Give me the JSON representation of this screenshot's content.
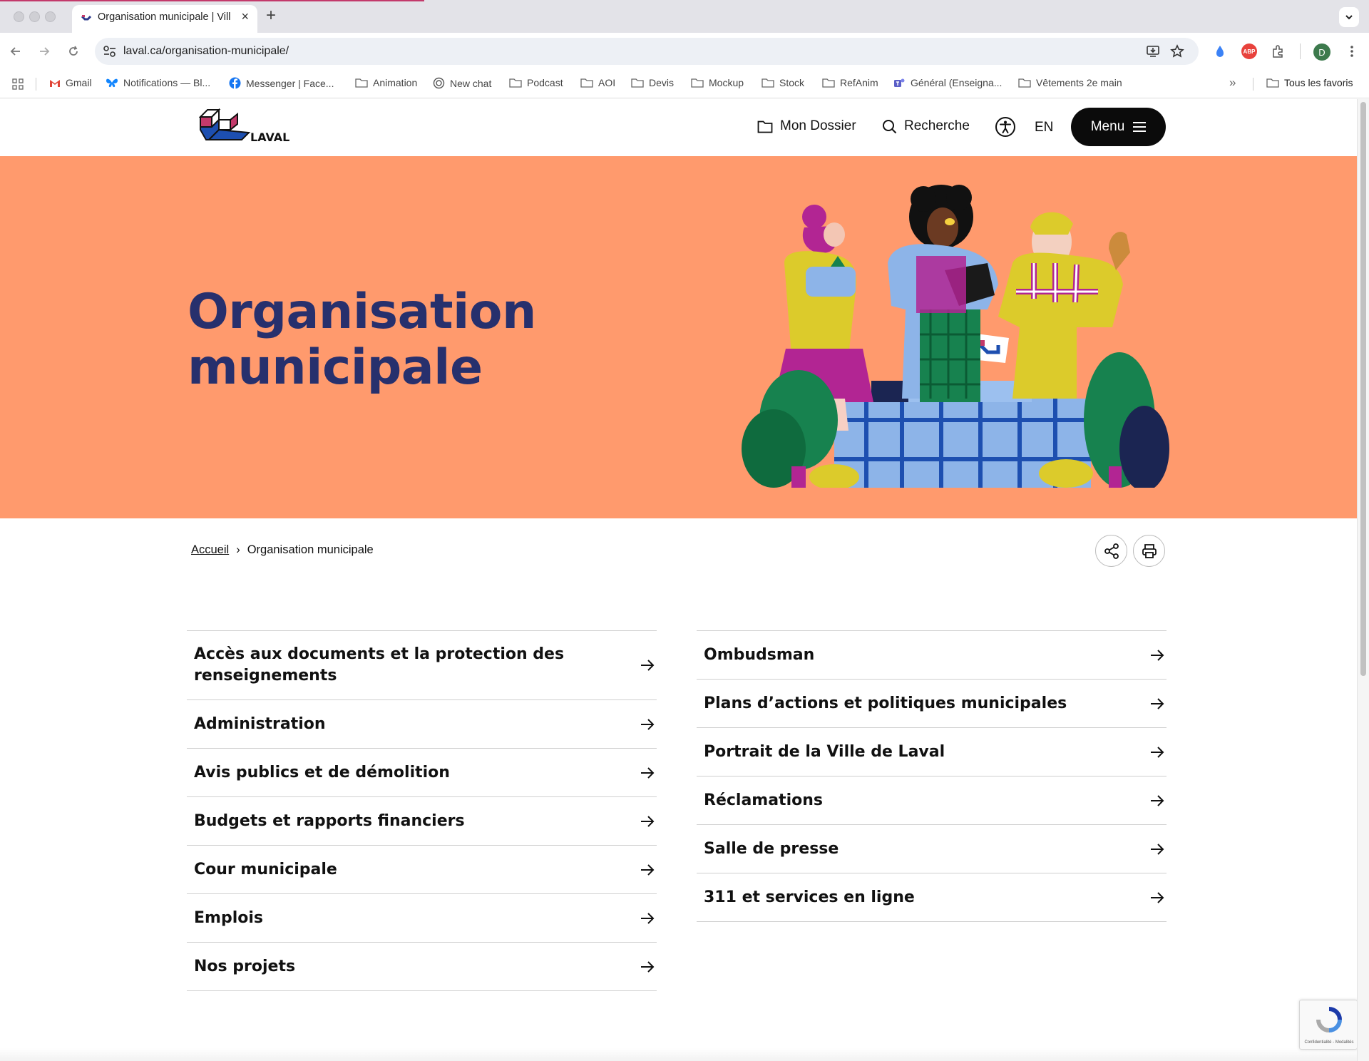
{
  "browser": {
    "tab_title": "Organisation municipale | Vill",
    "url_host": "laval.ca",
    "url_path": "/organisation-municipale/",
    "bookmarks": [
      {
        "label": "Gmail",
        "icon": "gmail-icon"
      },
      {
        "label": "Notifications — Bl...",
        "icon": "butterfly-icon"
      },
      {
        "label": "Messenger | Face...",
        "icon": "facebook-icon"
      },
      {
        "label": "Animation",
        "icon": "folder-icon"
      },
      {
        "label": "New chat",
        "icon": "chatgpt-icon"
      },
      {
        "label": "Podcast",
        "icon": "folder-icon"
      },
      {
        "label": "AOI",
        "icon": "folder-icon"
      },
      {
        "label": "Devis",
        "icon": "folder-icon"
      },
      {
        "label": "Mockup",
        "icon": "folder-icon"
      },
      {
        "label": "Stock",
        "icon": "folder-icon"
      },
      {
        "label": "RefAnim",
        "icon": "folder-icon"
      },
      {
        "label": "Général (Enseigna...",
        "icon": "teams-icon"
      },
      {
        "label": "Vêtements 2e main",
        "icon": "folder-icon"
      }
    ],
    "all_bookmarks": "Tous les favoris",
    "profile_initial": "D",
    "abp_label": "ABP"
  },
  "header": {
    "logo_text": "LAVAL",
    "dossier": "Mon Dossier",
    "search": "Recherche",
    "lang": "EN",
    "menu": "Menu"
  },
  "hero": {
    "title_line1": "Organisation",
    "title_line2": "municipale",
    "background": "#ff9a6d",
    "title_color": "#27306d"
  },
  "breadcrumb": {
    "home": "Accueil",
    "separator": "›",
    "current": "Organisation municipale"
  },
  "links_left": [
    "Accès aux documents et la protection des renseignements",
    "Administration",
    "Avis publics et de démolition",
    "Budgets et rapports financiers",
    "Cour municipale",
    "Emplois",
    "Nos projets"
  ],
  "links_right": [
    "Ombudsman",
    "Plans d’actions et politiques municipales",
    "Portrait de la Ville de Laval",
    "Réclamations",
    "Salle de presse",
    "311 et services en ligne"
  ],
  "recaptcha": "Confidentialité - Modalités"
}
